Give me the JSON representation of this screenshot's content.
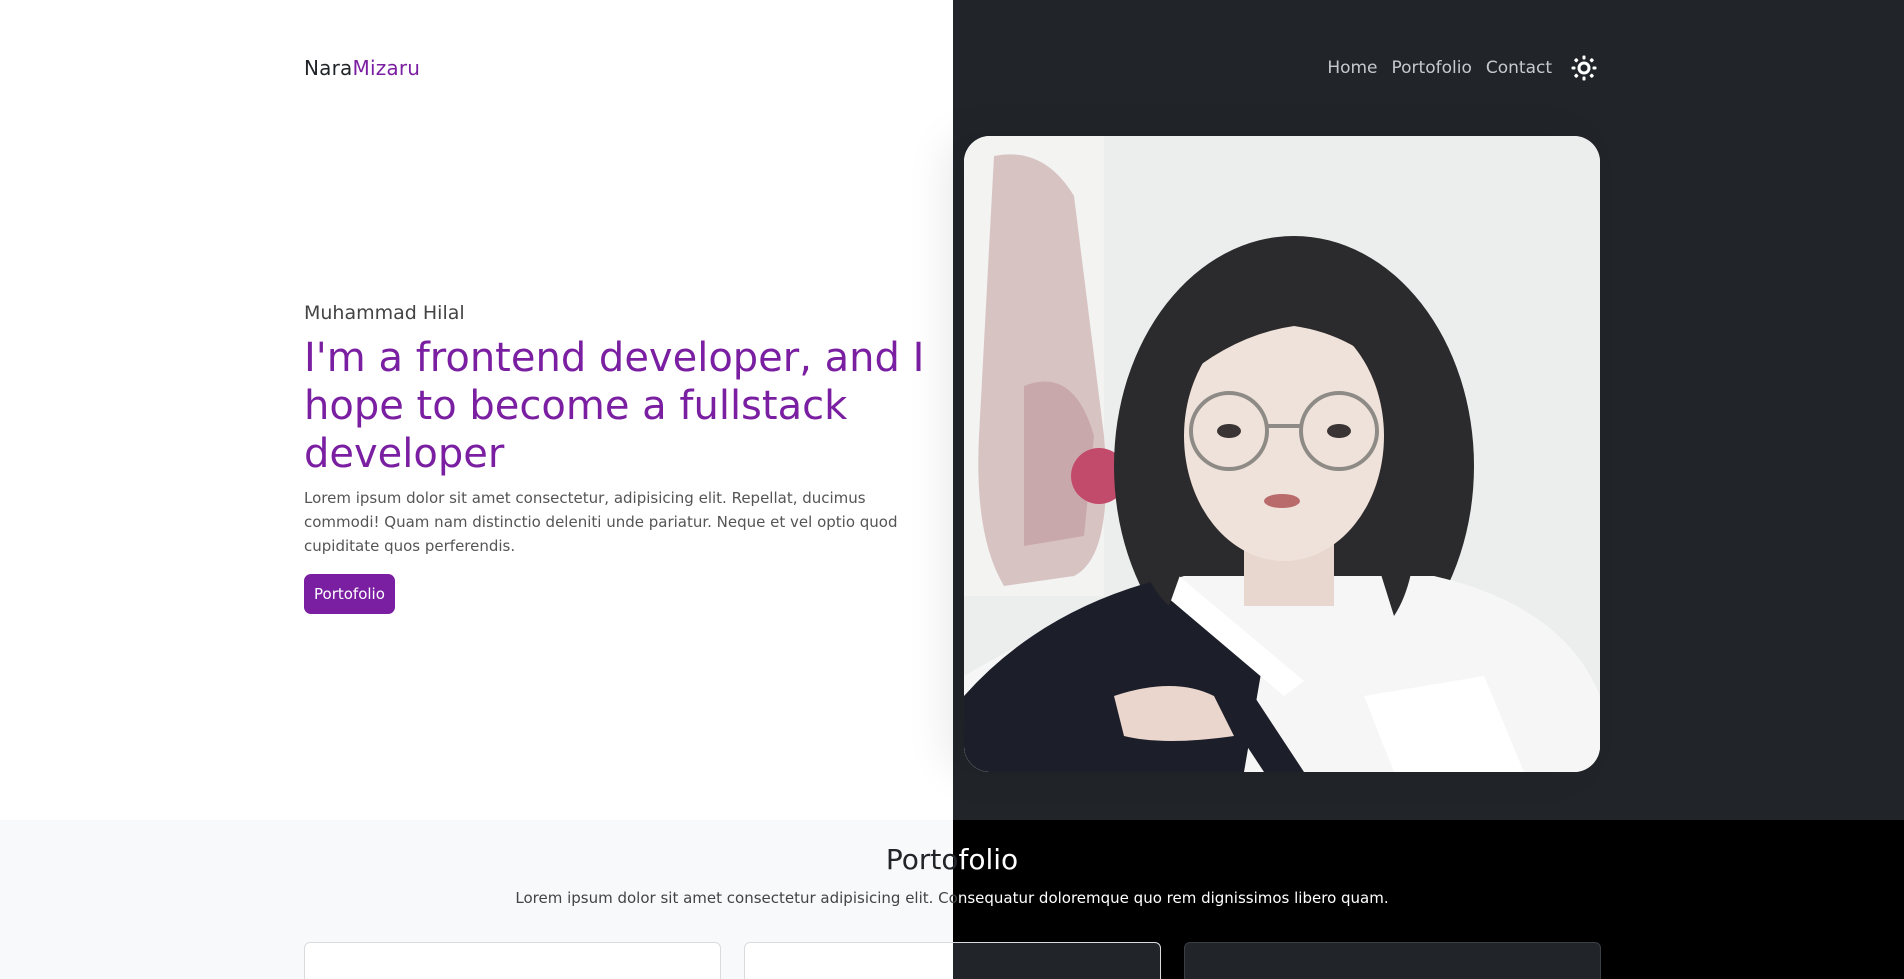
{
  "brand": {
    "part1": "Nara",
    "part2": "Mizaru"
  },
  "nav": {
    "items": [
      "Home",
      "Portofolio",
      "Contact"
    ],
    "theme_icon": "sun-icon"
  },
  "hero": {
    "name": "Muhammad Hilal",
    "headline": "I'm a frontend developer, and I hope to become a fullstack developer",
    "description": "Lorem ipsum dolor sit amet consectetur, adipisicing elit. Repellat, ducimus commodi! Quam nam distinctio deleniti unde pariatur. Neque et vel optio quod cupiditate quos perferendis.",
    "button_label": "Portofolio"
  },
  "portfolio": {
    "title_dark": "Porto",
    "title_light": "folio",
    "subtitle_dark": "Lorem ipsum dolor sit amet consectetur adipisicing elit. Co",
    "subtitle_light": "nsequatur doloremque quo rem dignissimos libero quam."
  },
  "colors": {
    "accent": "#7b1fa2",
    "dark_bg": "#212529",
    "light_bg": "#ffffff",
    "band_light": "#f8f9fa",
    "band_dark": "#000000"
  }
}
